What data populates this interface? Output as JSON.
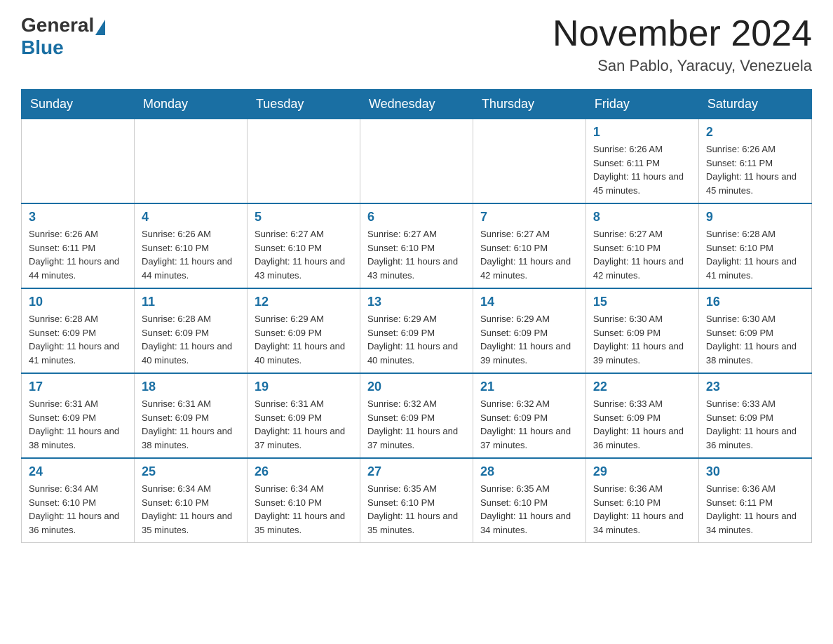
{
  "header": {
    "logo_general": "General",
    "logo_blue": "Blue",
    "month_title": "November 2024",
    "subtitle": "San Pablo, Yaracuy, Venezuela"
  },
  "weekdays": [
    "Sunday",
    "Monday",
    "Tuesday",
    "Wednesday",
    "Thursday",
    "Friday",
    "Saturday"
  ],
  "weeks": [
    [
      {
        "day": "",
        "info": ""
      },
      {
        "day": "",
        "info": ""
      },
      {
        "day": "",
        "info": ""
      },
      {
        "day": "",
        "info": ""
      },
      {
        "day": "",
        "info": ""
      },
      {
        "day": "1",
        "info": "Sunrise: 6:26 AM\nSunset: 6:11 PM\nDaylight: 11 hours and 45 minutes."
      },
      {
        "day": "2",
        "info": "Sunrise: 6:26 AM\nSunset: 6:11 PM\nDaylight: 11 hours and 45 minutes."
      }
    ],
    [
      {
        "day": "3",
        "info": "Sunrise: 6:26 AM\nSunset: 6:11 PM\nDaylight: 11 hours and 44 minutes."
      },
      {
        "day": "4",
        "info": "Sunrise: 6:26 AM\nSunset: 6:10 PM\nDaylight: 11 hours and 44 minutes."
      },
      {
        "day": "5",
        "info": "Sunrise: 6:27 AM\nSunset: 6:10 PM\nDaylight: 11 hours and 43 minutes."
      },
      {
        "day": "6",
        "info": "Sunrise: 6:27 AM\nSunset: 6:10 PM\nDaylight: 11 hours and 43 minutes."
      },
      {
        "day": "7",
        "info": "Sunrise: 6:27 AM\nSunset: 6:10 PM\nDaylight: 11 hours and 42 minutes."
      },
      {
        "day": "8",
        "info": "Sunrise: 6:27 AM\nSunset: 6:10 PM\nDaylight: 11 hours and 42 minutes."
      },
      {
        "day": "9",
        "info": "Sunrise: 6:28 AM\nSunset: 6:10 PM\nDaylight: 11 hours and 41 minutes."
      }
    ],
    [
      {
        "day": "10",
        "info": "Sunrise: 6:28 AM\nSunset: 6:09 PM\nDaylight: 11 hours and 41 minutes."
      },
      {
        "day": "11",
        "info": "Sunrise: 6:28 AM\nSunset: 6:09 PM\nDaylight: 11 hours and 40 minutes."
      },
      {
        "day": "12",
        "info": "Sunrise: 6:29 AM\nSunset: 6:09 PM\nDaylight: 11 hours and 40 minutes."
      },
      {
        "day": "13",
        "info": "Sunrise: 6:29 AM\nSunset: 6:09 PM\nDaylight: 11 hours and 40 minutes."
      },
      {
        "day": "14",
        "info": "Sunrise: 6:29 AM\nSunset: 6:09 PM\nDaylight: 11 hours and 39 minutes."
      },
      {
        "day": "15",
        "info": "Sunrise: 6:30 AM\nSunset: 6:09 PM\nDaylight: 11 hours and 39 minutes."
      },
      {
        "day": "16",
        "info": "Sunrise: 6:30 AM\nSunset: 6:09 PM\nDaylight: 11 hours and 38 minutes."
      }
    ],
    [
      {
        "day": "17",
        "info": "Sunrise: 6:31 AM\nSunset: 6:09 PM\nDaylight: 11 hours and 38 minutes."
      },
      {
        "day": "18",
        "info": "Sunrise: 6:31 AM\nSunset: 6:09 PM\nDaylight: 11 hours and 38 minutes."
      },
      {
        "day": "19",
        "info": "Sunrise: 6:31 AM\nSunset: 6:09 PM\nDaylight: 11 hours and 37 minutes."
      },
      {
        "day": "20",
        "info": "Sunrise: 6:32 AM\nSunset: 6:09 PM\nDaylight: 11 hours and 37 minutes."
      },
      {
        "day": "21",
        "info": "Sunrise: 6:32 AM\nSunset: 6:09 PM\nDaylight: 11 hours and 37 minutes."
      },
      {
        "day": "22",
        "info": "Sunrise: 6:33 AM\nSunset: 6:09 PM\nDaylight: 11 hours and 36 minutes."
      },
      {
        "day": "23",
        "info": "Sunrise: 6:33 AM\nSunset: 6:09 PM\nDaylight: 11 hours and 36 minutes."
      }
    ],
    [
      {
        "day": "24",
        "info": "Sunrise: 6:34 AM\nSunset: 6:10 PM\nDaylight: 11 hours and 36 minutes."
      },
      {
        "day": "25",
        "info": "Sunrise: 6:34 AM\nSunset: 6:10 PM\nDaylight: 11 hours and 35 minutes."
      },
      {
        "day": "26",
        "info": "Sunrise: 6:34 AM\nSunset: 6:10 PM\nDaylight: 11 hours and 35 minutes."
      },
      {
        "day": "27",
        "info": "Sunrise: 6:35 AM\nSunset: 6:10 PM\nDaylight: 11 hours and 35 minutes."
      },
      {
        "day": "28",
        "info": "Sunrise: 6:35 AM\nSunset: 6:10 PM\nDaylight: 11 hours and 34 minutes."
      },
      {
        "day": "29",
        "info": "Sunrise: 6:36 AM\nSunset: 6:10 PM\nDaylight: 11 hours and 34 minutes."
      },
      {
        "day": "30",
        "info": "Sunrise: 6:36 AM\nSunset: 6:11 PM\nDaylight: 11 hours and 34 minutes."
      }
    ]
  ]
}
